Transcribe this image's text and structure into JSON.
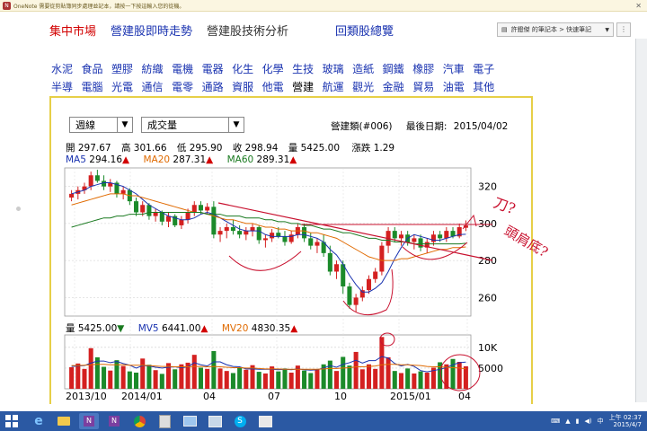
{
  "onenote_bar": {
    "text": "OneNote 需要從剪貼簿同步處理並記本，請按一下按這輸入您的從機。"
  },
  "top_nav": [
    {
      "label": "集中市場",
      "color": "#d20000"
    },
    {
      "label": "營建股即時走勢",
      "color": "#1a33b0"
    },
    {
      "label": "營建股技術分析",
      "color": "#333333"
    },
    {
      "label": "回類股總覽",
      "color": "#1a33b0"
    }
  ],
  "notebook_selector": {
    "value": "許鐙傑 的筆記本 > 快速筆記"
  },
  "categories": {
    "row1": [
      "水泥",
      "食品",
      "塑膠",
      "紡織",
      "電機",
      "電器",
      "化生",
      "化學",
      "生技",
      "玻璃",
      "造紙",
      "鋼鐵",
      "橡膠",
      "汽車",
      "電子"
    ],
    "row2": [
      "半導",
      "電腦",
      "光電",
      "通信",
      "電零",
      "通路",
      "資服",
      "他電",
      "營建",
      "航運",
      "觀光",
      "金融",
      "貿易",
      "油電",
      "其他"
    ],
    "active": "營建"
  },
  "controls": {
    "period": "週線",
    "indicator": "成交量"
  },
  "header": {
    "category": "營建類(#006)",
    "last_date_label": "最後日期:",
    "last_date": "2015/04/02"
  },
  "ohlc": {
    "open_label": "開",
    "open": "297.67",
    "high_label": "高",
    "high": "301.66",
    "low_label": "低",
    "low": "295.90",
    "close_label": "收",
    "close": "298.94",
    "volume_label": "量",
    "volume": "5425.00",
    "change_label": "漲跌",
    "change": "1.29"
  },
  "ma": [
    {
      "label": "MA5",
      "value": "294.16",
      "arrow": "▲",
      "color": "#1a33b0"
    },
    {
      "label": "MA20",
      "value": "287.31",
      "arrow": "▲",
      "color": "#e06a00"
    },
    {
      "label": "MA60",
      "value": "289.31",
      "arrow": "▲",
      "color": "#1a7a20"
    }
  ],
  "vol_info": {
    "vol_label": "量",
    "vol": "5425.00",
    "vol_arrow": "▼",
    "mv5_label": "MV5",
    "mv5": "6441.00",
    "mv5_arrow": "▲",
    "mv20_label": "MV20",
    "mv20": "4830.35",
    "mv20_arrow": "▲"
  },
  "price_axis": [
    "320",
    "300",
    "280",
    "260"
  ],
  "volume_axis": [
    "10K",
    "5000"
  ],
  "x_axis": [
    "2013/10",
    "2014/01",
    "04",
    "07",
    "10",
    "2015/01",
    "04"
  ],
  "annotation": {
    "text": "刀? 頭肩底?",
    "color": "#c8102e"
  },
  "chart_data": [
    {
      "type": "candlestick",
      "title": "",
      "ylim": [
        250,
        330
      ],
      "yticks": [
        260,
        280,
        300,
        320
      ],
      "xticks": [
        "2013/10",
        "2014/01",
        "04",
        "07",
        "10",
        "2015/01",
        "04"
      ],
      "series": [
        {
          "name": "OHLC",
          "values": [
            [
              314,
              318,
              312,
              316
            ],
            [
              316,
              320,
              313,
              318
            ],
            [
              318,
              322,
              316,
              320
            ],
            [
              320,
              328,
              318,
              326
            ],
            [
              326,
              329,
              322,
              323
            ],
            [
              323,
              326,
              318,
              320
            ],
            [
              320,
              324,
              317,
              322
            ],
            [
              322,
              323,
              314,
              316
            ],
            [
              316,
              320,
              313,
              318
            ],
            [
              318,
              319,
              310,
              312
            ],
            [
              312,
              314,
              304,
              306
            ],
            [
              306,
              312,
              304,
              310
            ],
            [
              310,
              311,
              302,
              304
            ],
            [
              304,
              308,
              301,
              306
            ],
            [
              306,
              307,
              299,
              301
            ],
            [
              301,
              306,
              298,
              304
            ],
            [
              304,
              305,
              298,
              299
            ],
            [
              299,
              304,
              297,
              302
            ],
            [
              302,
              308,
              300,
              306
            ],
            [
              306,
              312,
              304,
              310
            ],
            [
              310,
              312,
              305,
              307
            ],
            [
              307,
              311,
              305,
              309
            ],
            [
              309,
              312,
              292,
              294
            ],
            [
              294,
              298,
              290,
              296
            ],
            [
              296,
              300,
              292,
              298
            ],
            [
              298,
              302,
              294,
              296
            ],
            [
              296,
              299,
              292,
              294
            ],
            [
              294,
              298,
              291,
              296
            ],
            [
              296,
              300,
              293,
              298
            ],
            [
              298,
              299,
              289,
              291
            ],
            [
              291,
              294,
              287,
              292
            ],
            [
              292,
              297,
              290,
              295
            ],
            [
              295,
              298,
              292,
              293
            ],
            [
              293,
              296,
              288,
              290
            ],
            [
              290,
              296,
              289,
              294
            ],
            [
              294,
              300,
              292,
              298
            ],
            [
              298,
              300,
              290,
              292
            ],
            [
              292,
              295,
              286,
              288
            ],
            [
              288,
              292,
              284,
              290
            ],
            [
              290,
              294,
              282,
              284
            ],
            [
              284,
              288,
              272,
              274
            ],
            [
              274,
              280,
              270,
              278
            ],
            [
              278,
              280,
              262,
              266
            ],
            [
              266,
              268,
              254,
              256
            ],
            [
              256,
              262,
              252,
              260
            ],
            [
              260,
              266,
              258,
              264
            ],
            [
              264,
              272,
              262,
              270
            ],
            [
              270,
              276,
              268,
              274
            ],
            [
              274,
              290,
              272,
              288
            ],
            [
              288,
              298,
              284,
              296
            ],
            [
              296,
              298,
              290,
              292
            ],
            [
              292,
              296,
              288,
              294
            ],
            [
              294,
              296,
              288,
              290
            ],
            [
              290,
              294,
              286,
              292
            ],
            [
              292,
              294,
              285,
              287
            ],
            [
              287,
              292,
              284,
              290
            ],
            [
              290,
              296,
              288,
              294
            ],
            [
              294,
              296,
              290,
              292
            ],
            [
              292,
              298,
              290,
              296
            ],
            [
              296,
              298,
              292,
              293
            ],
            [
              293,
              300,
              292,
              298
            ],
            [
              297.67,
              301.66,
              295.9,
              298.94
            ]
          ]
        },
        {
          "name": "MA5",
          "values": [
            316,
            317,
            318,
            320,
            321,
            322,
            322,
            321,
            320,
            318,
            316,
            313,
            310,
            308,
            306,
            304,
            303,
            302,
            302,
            303,
            305,
            306,
            305,
            303,
            301,
            299,
            297,
            296,
            296,
            296,
            294,
            293,
            293,
            293,
            293,
            294,
            294,
            293,
            292,
            290,
            286,
            283,
            278,
            272,
            267,
            263,
            263,
            265,
            268,
            274,
            281,
            287,
            292,
            294,
            293,
            292,
            291,
            291,
            292,
            293,
            294,
            294.16
          ]
        },
        {
          "name": "MA20",
          "values": [
            310,
            311,
            312,
            313,
            314,
            315,
            316,
            316,
            316,
            315,
            315,
            314,
            313,
            312,
            311,
            310,
            309,
            308,
            307,
            306,
            306,
            305,
            304,
            303,
            302,
            302,
            301,
            300,
            300,
            299,
            298,
            298,
            297,
            297,
            296,
            296,
            296,
            295,
            295,
            294,
            293,
            292,
            290,
            288,
            286,
            284,
            282,
            281,
            280,
            280,
            280,
            281,
            281,
            282,
            283,
            284,
            285,
            286,
            286,
            287,
            287,
            287.31
          ]
        },
        {
          "name": "MA60",
          "values": [
            298,
            299,
            300,
            301,
            302,
            303,
            303,
            304,
            304,
            305,
            305,
            305,
            306,
            306,
            306,
            306,
            306,
            306,
            306,
            306,
            306,
            305,
            305,
            305,
            304,
            304,
            304,
            303,
            303,
            303,
            302,
            302,
            301,
            301,
            300,
            300,
            299,
            299,
            298,
            297,
            297,
            296,
            295,
            295,
            294,
            293,
            292,
            292,
            291,
            291,
            290,
            290,
            290,
            289,
            289,
            289,
            289,
            289,
            289,
            289,
            289,
            289.31
          ]
        }
      ]
    },
    {
      "type": "bar",
      "title": "",
      "ylim": [
        0,
        13000
      ],
      "yticks": [
        5000,
        10000
      ],
      "series": [
        {
          "name": "Volume",
          "values": [
            5200,
            6100,
            4800,
            9800,
            7600,
            5300,
            4400,
            6900,
            5500,
            4200,
            3900,
            7300,
            5800,
            4500,
            3600,
            6200,
            4700,
            5900,
            6300,
            8200,
            5100,
            4800,
            9100,
            4900,
            4300,
            3800,
            5200,
            4600,
            5700,
            4100,
            3700,
            5400,
            4200,
            4900,
            3900,
            5600,
            4400,
            3800,
            4700,
            5900,
            6800,
            4300,
            7700,
            5600,
            8900,
            4700,
            5900,
            4800,
            12500,
            7600,
            4300,
            3800,
            4900,
            3700,
            4200,
            3900,
            5100,
            6400,
            5900,
            7200,
            6500,
            5425
          ]
        },
        {
          "name": "MV5",
          "values": [
            5400,
            5500,
            5600,
            6200,
            6700,
            6700,
            6300,
            6600,
            6100,
            5700,
            5000,
            5600,
            5500,
            5200,
            5000,
            5200,
            5300,
            5100,
            5300,
            6300,
            5800,
            5500,
            6500,
            6500,
            5800,
            5400,
            5300,
            4800,
            4800,
            4700,
            4700,
            4700,
            4600,
            4700,
            4600,
            4800,
            4600,
            4500,
            4600,
            5000,
            5600,
            5200,
            5900,
            6300,
            6900,
            6200,
            6800,
            6800,
            7800,
            7400,
            6100,
            5500,
            5900,
            5400,
            4400,
            4100,
            4400,
            4700,
            5100,
            5800,
            6300,
            6441
          ]
        },
        {
          "name": "MV20",
          "values": [
            5600,
            5600,
            5700,
            5800,
            5900,
            5900,
            5800,
            5800,
            5800,
            5700,
            5700,
            5700,
            5600,
            5500,
            5400,
            5400,
            5300,
            5300,
            5300,
            5400,
            5400,
            5300,
            5400,
            5300,
            5200,
            5100,
            5100,
            5000,
            5000,
            4900,
            4800,
            4800,
            4800,
            4700,
            4700,
            4700,
            4700,
            4700,
            4700,
            4800,
            4900,
            4900,
            5000,
            5100,
            5300,
            5300,
            5400,
            5500,
            5800,
            5900,
            5900,
            5800,
            5800,
            5700,
            5600,
            5400,
            5300,
            5300,
            5200,
            5100,
            5000,
            4830
          ]
        }
      ]
    }
  ]
}
